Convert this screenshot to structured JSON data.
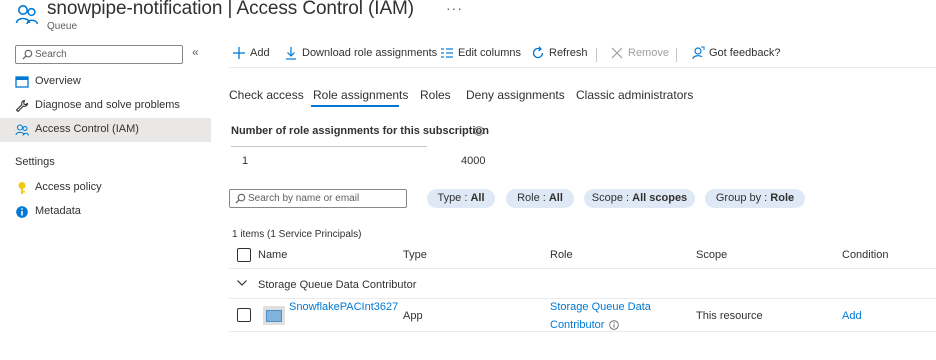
{
  "header": {
    "resource_name": "snowpipe-notification",
    "separator": " | ",
    "blade_title": "Access Control (IAM)",
    "resource_type": "Queue",
    "more_label": "···"
  },
  "sidebar": {
    "search_placeholder": "Search",
    "collapse_label": "«",
    "items": [
      {
        "label": "Overview",
        "icon": "overview-icon"
      },
      {
        "label": "Diagnose and solve problems",
        "icon": "wrench-icon"
      },
      {
        "label": "Access Control (IAM)",
        "icon": "people-icon",
        "active": true
      }
    ],
    "section_settings": "Settings",
    "settings_items": [
      {
        "label": "Access policy",
        "icon": "key-icon"
      },
      {
        "label": "Metadata",
        "icon": "info-icon"
      }
    ]
  },
  "toolbar": {
    "add": "Add",
    "download": "Download role assignments",
    "edit_columns": "Edit columns",
    "refresh": "Refresh",
    "remove": "Remove",
    "feedback": "Got feedback?"
  },
  "tabs": [
    "Check access",
    "Role assignments",
    "Roles",
    "Deny assignments",
    "Classic administrators"
  ],
  "active_tab": "Role assignments",
  "count_section": {
    "title": "Number of role assignments for this subscription",
    "current": "1",
    "max": "4000"
  },
  "filters": {
    "search_placeholder": "Search by name or email",
    "type": {
      "label": "Type : ",
      "value": "All"
    },
    "role": {
      "label": "Role : ",
      "value": "All"
    },
    "scope": {
      "label": "Scope : ",
      "value": "All scopes"
    },
    "group_by": {
      "label": "Group by : ",
      "value": "Role"
    }
  },
  "table": {
    "items_count": "1 items (1 Service Principals)",
    "columns": [
      "Name",
      "Type",
      "Role",
      "Scope",
      "Condition"
    ],
    "group": "Storage Queue Data Contributor",
    "rows": [
      {
        "name": "SnowflakePACInt3627",
        "type": "App",
        "role_line1": "Storage Queue Data",
        "role_line2": "Contributor",
        "scope": "This resource",
        "condition": "Add"
      }
    ]
  },
  "colors": {
    "accent": "#0078d4",
    "pill_bg": "#dfe9f6",
    "active_nav_bg": "#e9e8e7",
    "key_icon": "#f2c811"
  }
}
